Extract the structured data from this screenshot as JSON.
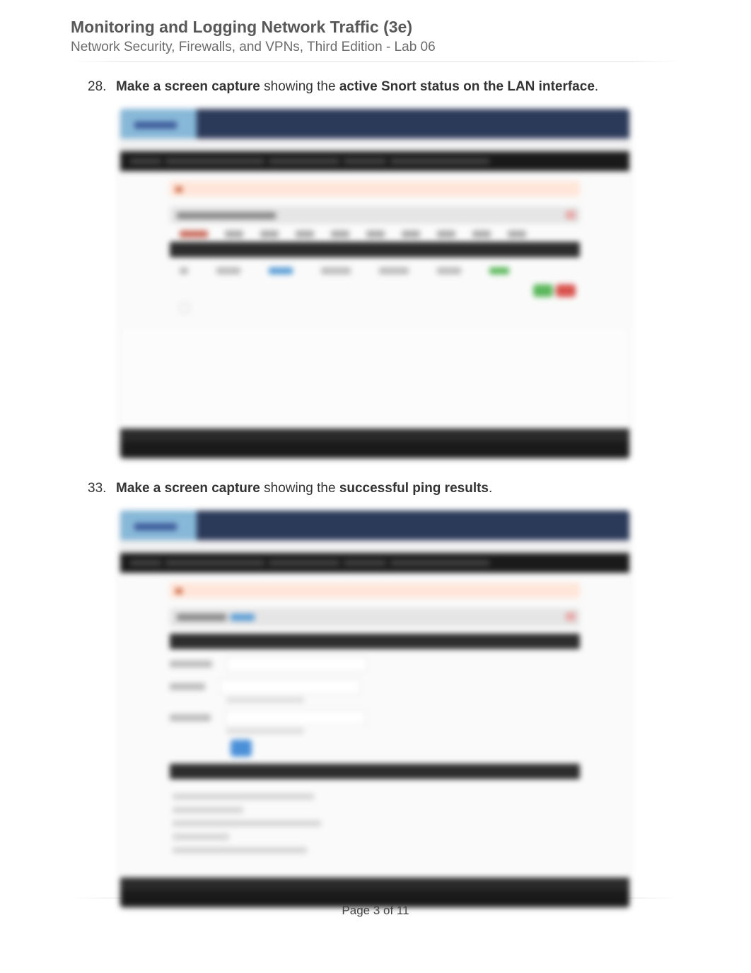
{
  "header": {
    "title": "Monitoring and Logging Network Traffic (3e)",
    "subtitle": "Network Security, Firewalls, and VPNs, Third Edition - Lab 06"
  },
  "steps": {
    "s28": {
      "number": "28.",
      "lead_bold": "Make a screen capture",
      "mid": " showing the ",
      "object_bold": "active Snort status on the LAN interface",
      "tail": "."
    },
    "s33": {
      "number": "33.",
      "lead_bold": "Make a screen capture",
      "mid": " showing the ",
      "object_bold": "successful ping results",
      "tail": "."
    }
  },
  "footer": {
    "page": "Page 3 of 11"
  }
}
